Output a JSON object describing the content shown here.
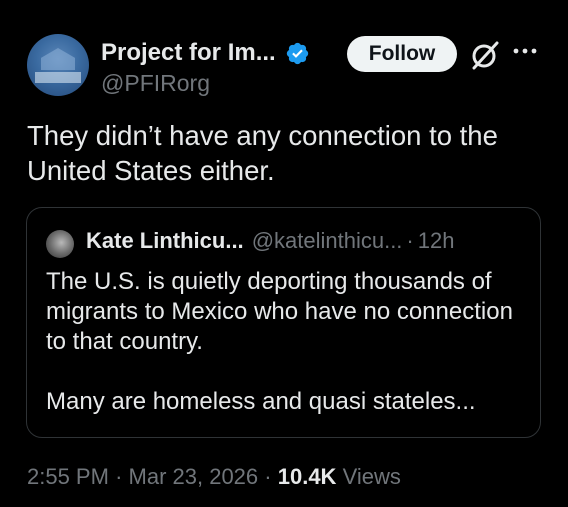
{
  "tweet": {
    "display_name": "Project for Im...",
    "handle": "@PFIRorg",
    "follow_label": "Follow",
    "text": "They didn’t have any connection to the United States either.",
    "verified_color": "#1d9bf0"
  },
  "quote": {
    "display_name": "Kate Linthicu...",
    "handle": "@katelinthicu...",
    "separator": "·",
    "time": "12h",
    "paragraphs": [
      "The U.S. is quietly deporting thousands of migrants to Mexico who have no connection to that country.",
      "Many are homeless and quasi stateles..."
    ]
  },
  "meta": {
    "time": "2:55 PM",
    "separator1": "·",
    "date": "Mar 23, 2026",
    "separator2": "·",
    "views_count": "10.4K",
    "views_label": "Views"
  },
  "icons": {
    "verified": "verified-badge-icon",
    "grok": "grok-icon",
    "more": "more-icon"
  }
}
